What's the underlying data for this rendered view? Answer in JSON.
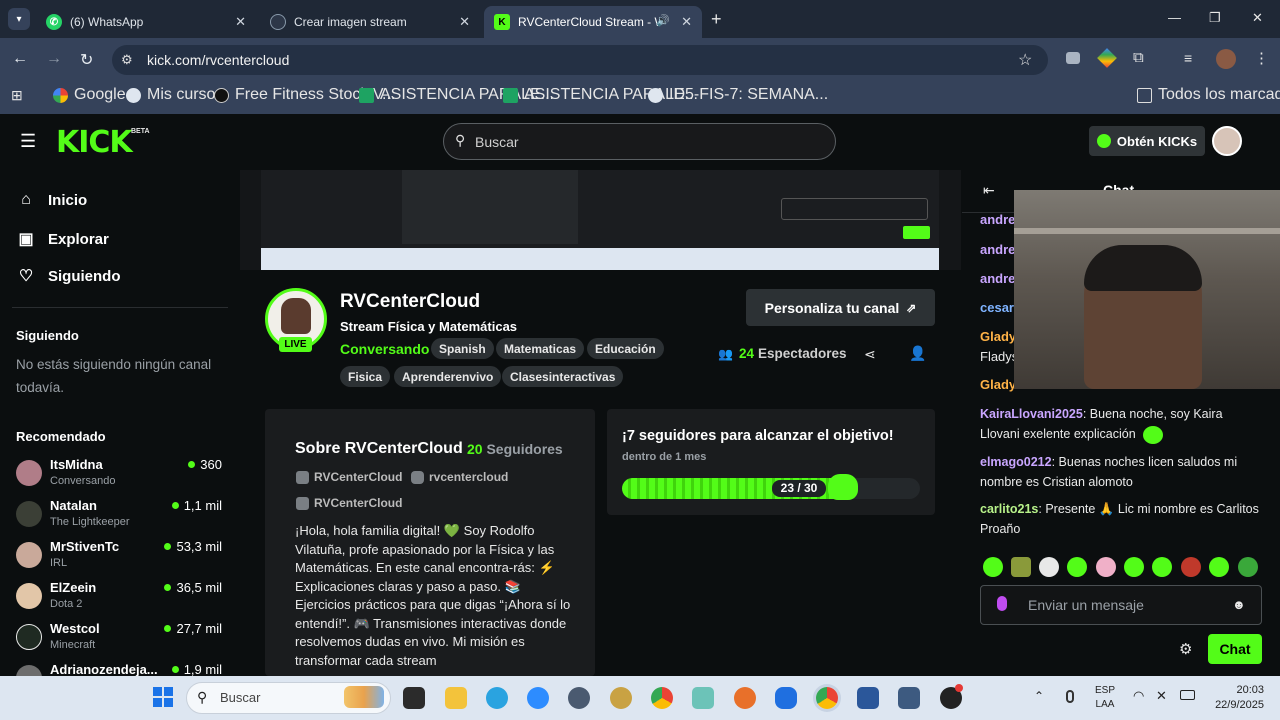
{
  "browser": {
    "tabs": [
      {
        "title": "(6) WhatsApp",
        "favicon_color": "#25d366"
      },
      {
        "title": "Crear imagen stream",
        "favicon_color": "#4a5568"
      },
      {
        "title": "RVCenterCloud Stream - W",
        "favicon_color": "#53fc18"
      }
    ],
    "url": "kick.com/rvcentercloud",
    "bookmarks": [
      "Google",
      "Mis cursos",
      "Free Fitness Stock V...",
      "ASISTENCIA PARALE...",
      "ASISTENCIA PARALE...",
      "ID5-FIS-7: SEMANA..."
    ],
    "all_bookmarks": "Todos los marcadores"
  },
  "kick": {
    "logo": "KICK",
    "beta": "BETA",
    "search_placeholder": "Buscar",
    "get_kicks": "Obtén KICKs"
  },
  "sidebar": {
    "nav": [
      "Inicio",
      "Explorar",
      "Siguiendo"
    ],
    "following_heading": "Siguiendo",
    "following_empty": "No estás siguiendo ningún canal todavía.",
    "recommended_heading": "Recomendado",
    "recommended": [
      {
        "name": "ItsMidna",
        "category": "Conversando",
        "viewers": "360"
      },
      {
        "name": "Natalan",
        "category": "The Lightkeeper",
        "viewers": "1,1 mil"
      },
      {
        "name": "MrStivenTc",
        "category": "IRL",
        "viewers": "53,3 mil"
      },
      {
        "name": "ElZeein",
        "category": "Dota 2",
        "viewers": "36,5 mil"
      },
      {
        "name": "Westcol",
        "category": "Minecraft",
        "viewers": "27,7 mil"
      },
      {
        "name": "Adrianozendeja...",
        "category": "",
        "viewers": "1,9 mil"
      }
    ]
  },
  "channel": {
    "name": "RVCenterCloud",
    "live": "LIVE",
    "title": "Stream Física y Matemáticas",
    "category": "Conversando",
    "tags": [
      "Spanish",
      "Matematicas",
      "Educación",
      "Fisica",
      "Aprenderenvivo",
      "Clasesinteractivas"
    ],
    "customize": "Personaliza tu canal",
    "viewers_count": "24",
    "viewers_label": "Espectadores"
  },
  "about": {
    "heading": "Sobre RVCenterCloud",
    "followers_count": "20",
    "followers_label": "Seguidores",
    "socials": [
      "RVCenterCloud",
      "rvcentercloud",
      "RVCenterCloud"
    ],
    "bio": "¡Hola, hola familia digital! 💚 Soy Rodolfo Vilatuña, profe apasionado por la Física y las Matemáticas. En este canal encontra-rás: ⚡ Explicaciones claras y paso a paso. 📚 Ejercicios prácticos para que digas “¡Ahora sí lo entendí!”. 🎮 Transmisiones interactivas donde resolvemos dudas en vivo. Mi misión es transformar cada stream"
  },
  "goal": {
    "heading": "¡7 seguidores para alcanzar el objetivo!",
    "sub": "dentro de 1 mes",
    "progress_label": "23 / 30",
    "progress": 0.767
  },
  "chat": {
    "heading": "Chat",
    "partial_users": [
      "andre",
      "andre",
      "andre",
      "cesar",
      "Glady",
      "Fladys",
      "Glady"
    ],
    "messages": [
      {
        "user": "KairaLlovani2025",
        "color": "#c9a6ff",
        "text": "Buena noche, soy Kaira Llovani exelente explicación"
      },
      {
        "user": "elmago0212",
        "color": "#c9a6ff",
        "text": "Buenas noches licen saludos mi nombre es Cristian alomoto"
      },
      {
        "user": "carlito21s",
        "color": "#b8f28a",
        "text": "Presente 🙏 Lic mi nombre es Carlitos Proaño"
      }
    ],
    "input_placeholder": "Enviar un mensaje",
    "send": "Chat"
  },
  "taskbar": {
    "search": "Buscar",
    "lang1": "ESP",
    "lang2": "LAA",
    "time": "20:03",
    "date": "22/9/2025"
  }
}
